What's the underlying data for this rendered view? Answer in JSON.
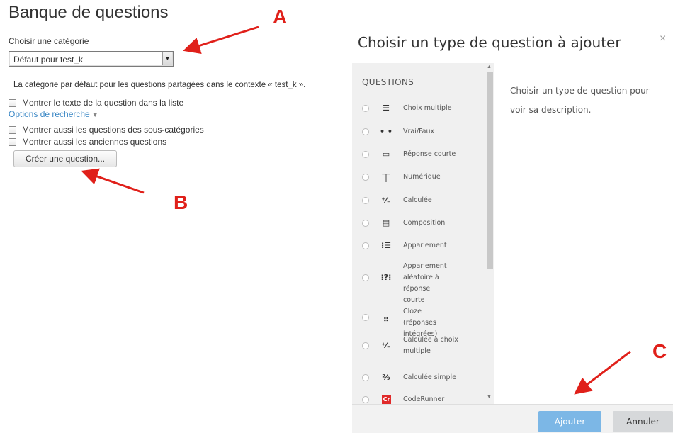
{
  "page": {
    "title": "Banque de questions",
    "category_label": "Choisir une catégorie",
    "category_value": "Défaut pour test_k",
    "category_description": "La catégorie par défaut pour les questions partagées dans le contexte « test_k ».",
    "show_question_text": "Montrer le texte de la question dans la liste",
    "search_options": "Options de recherche",
    "show_subcategories": "Montrer aussi les questions des sous-catégories",
    "show_old": "Montrer aussi les anciennes questions",
    "create_button": "Créer une question..."
  },
  "annotations": {
    "a": "A",
    "b": "B",
    "c": "C",
    "color": "#e0201a"
  },
  "modal": {
    "title": "Choisir un type de question à ajouter",
    "close": "×",
    "section_header": "QUESTIONS",
    "description": "Choisir un type de question pour voir sa description.",
    "add_button": "Ajouter",
    "cancel_button": "Annuler",
    "accent": "#7cb7e6",
    "question_types": [
      {
        "label": "Choix multiple",
        "icon": "list-icon",
        "glyph": "☰"
      },
      {
        "label": "Vrai/Faux",
        "icon": "dots-icon",
        "glyph": "• •"
      },
      {
        "label": "Réponse courte",
        "icon": "input-box-icon",
        "glyph": "▭"
      },
      {
        "label": "Numérique",
        "icon": "numeric-icon",
        "glyph": "⏉"
      },
      {
        "label": "Calculée",
        "icon": "calculated-icon",
        "glyph": "⁺⁄₌"
      },
      {
        "label": "Composition",
        "icon": "document-icon",
        "glyph": "▤"
      },
      {
        "label": "Appariement",
        "icon": "matching-icon",
        "glyph": "⁝☰"
      },
      {
        "label": "Appariement aléatoire à réponse courte",
        "icon": "random-matching-icon",
        "glyph": "⁝?⁝"
      },
      {
        "label": "Cloze (réponses intégrées)",
        "icon": "cloze-icon",
        "glyph": "⣤"
      },
      {
        "label": "Calculée à choix multiple",
        "icon": "calculated-multichoice-icon",
        "glyph": "⁺⁄₌"
      },
      {
        "label": "Calculée simple",
        "icon": "calculated-simple-icon",
        "glyph": "²⁄₉"
      },
      {
        "label": "CodeRunner",
        "icon": "coderunner-icon",
        "glyph": "Cr"
      }
    ]
  }
}
